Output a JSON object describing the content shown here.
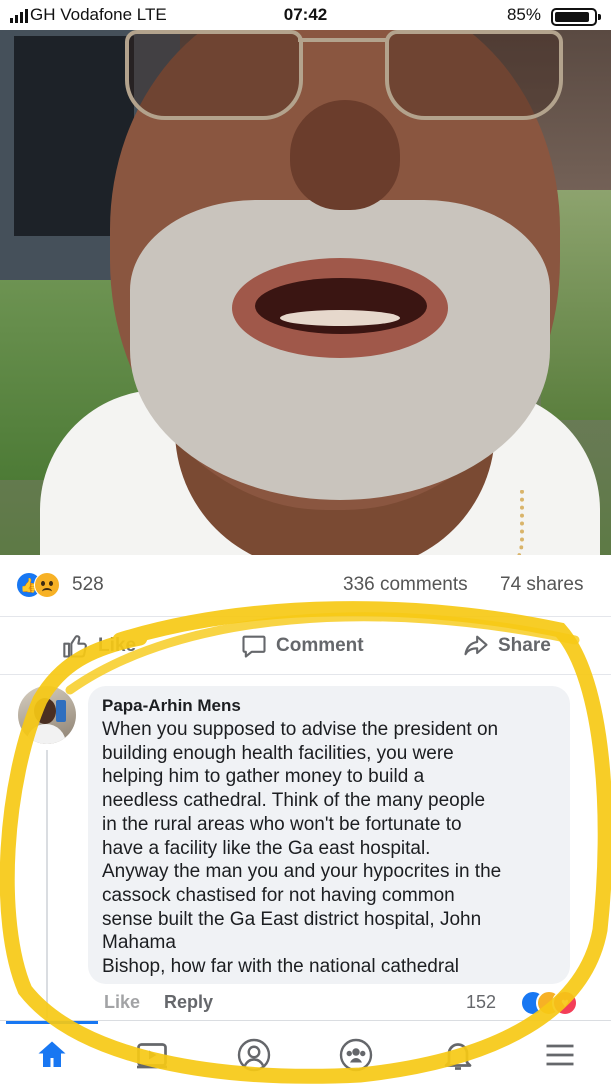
{
  "status_bar": {
    "carrier": "GH Vodafone  LTE",
    "time": "07:42",
    "battery": "85%"
  },
  "post": {
    "reaction_count": "528",
    "comments": "336 comments",
    "shares": "74 shares",
    "actions": {
      "like": "Like",
      "comment": "Comment",
      "share": "Share"
    }
  },
  "comment": {
    "author": "Papa-Arhin Mens",
    "text": "When you supposed to advise the president on\nbuilding enough health facilities, you were\nhelping him to gather money to build a\nneedless cathedral. Think of the many people\nin the rural areas who won't be fortunate to\nhave a facility like the Ga east hospital.\nAnyway the man you and your hypocrites in the\ncassock chastised for not having common\nsense built the Ga East district hospital, John\nMahama\nBishop, how far with the national cathedral",
    "like_label": "Like",
    "reply_label": "Reply",
    "reaction_count": "152"
  },
  "bottom_nav": {
    "items": [
      "home-icon",
      "watch-icon",
      "profile-icon",
      "groups-icon",
      "notifications-icon",
      "menu-icon"
    ],
    "active": "home-icon"
  },
  "colors": {
    "facebook_blue": "#1877f2",
    "highlight_yellow": "#f6c915",
    "text_gray": "#65676b"
  }
}
